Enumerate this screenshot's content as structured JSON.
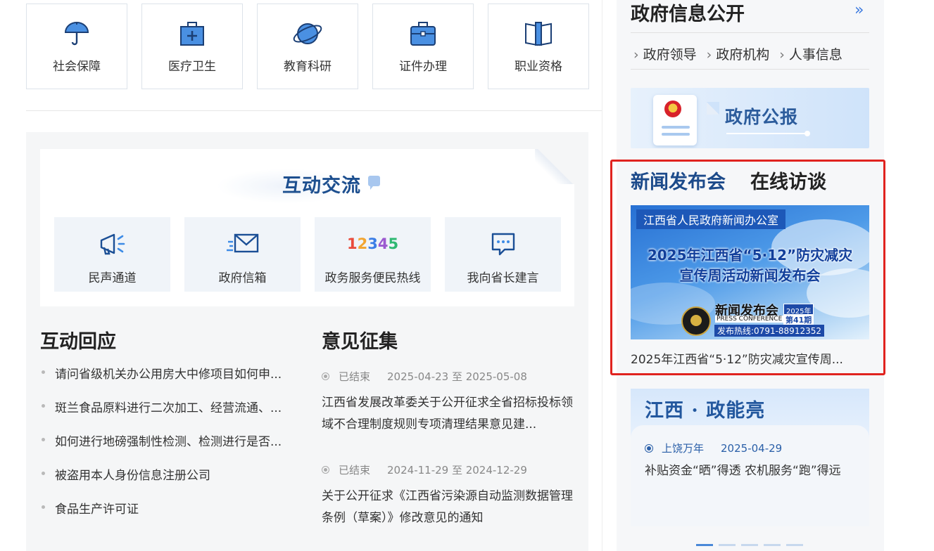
{
  "services": [
    {
      "label": "社会保障",
      "icon": "umbrella-icon"
    },
    {
      "label": "医疗卫生",
      "icon": "medical-kit-icon"
    },
    {
      "label": "教育科研",
      "icon": "planet-icon"
    },
    {
      "label": "证件办理",
      "icon": "briefcase-icon"
    },
    {
      "label": "职业资格",
      "icon": "book-icon"
    }
  ],
  "interaction": {
    "title": "互动交流",
    "quick": [
      {
        "label": "民声通道",
        "icon": "megaphone-icon"
      },
      {
        "label": "政府信箱",
        "icon": "mail-icon"
      },
      {
        "label": "政务服务便民热线",
        "icon": "hotline-12345-icon",
        "digits": [
          "1",
          "2",
          "3",
          "4",
          "5"
        ]
      },
      {
        "label": "我向省长建言",
        "icon": "chat-bubble-icon"
      }
    ],
    "digit_colors": [
      "#e94b3c",
      "#f2a531",
      "#3c7ee6",
      "#9b59d0",
      "#2eb872"
    ]
  },
  "response": {
    "title": "互动回应",
    "items": [
      "请问省级机关办公用房大中修项目如何申...",
      "斑兰食品原料进行二次加工、经营流通、...",
      "如何进行地磅强制性检测、检测进行是否...",
      "被盗用本人身份信息注册公司",
      "食品生产许可证"
    ]
  },
  "opinions": {
    "title": "意见征集",
    "items": [
      {
        "status": "已结束",
        "range": "2025-04-23 至 2025-05-08",
        "text": "江西省发展改革委关于公开征求全省招标投标领域不合理制度规则专项清理结果意见建..."
      },
      {
        "status": "已结束",
        "range": "2024-11-29 至 2024-12-29",
        "text": "关于公开征求《江西省污染源自动监测数据管理条例（草案）》修改意见的通知"
      }
    ]
  },
  "gov_info": {
    "title": "政府信息公开",
    "more": "»",
    "nav": [
      "政府领导",
      "政府机构",
      "人事信息"
    ],
    "bulletin_label": "政府公报"
  },
  "press": {
    "tabs": [
      "新闻发布会",
      "在线访谈"
    ],
    "active_color": "#1c4a8a",
    "image": {
      "org": "江西省人民政府新闻办公室",
      "line1": "2025年江西省“5·12”防灾减灾",
      "line2": "宣传周活动新闻发布会",
      "badge_title": "新闻发布会",
      "badge_sub": "PRESS CONFERENCE",
      "year": "2025年",
      "issue": "第41期",
      "hotline": "发布热线:0791-88912352"
    },
    "caption": "2025年江西省“5·12”防灾减灾宣传周..."
  },
  "jiangxi": {
    "title": "江西 · 政能亮",
    "source": "上饶万年",
    "date": "2025-04-29",
    "text": "补贴资金“晒”得透 农机服务“跑”得远",
    "slides": 5,
    "active_slide": 0
  }
}
